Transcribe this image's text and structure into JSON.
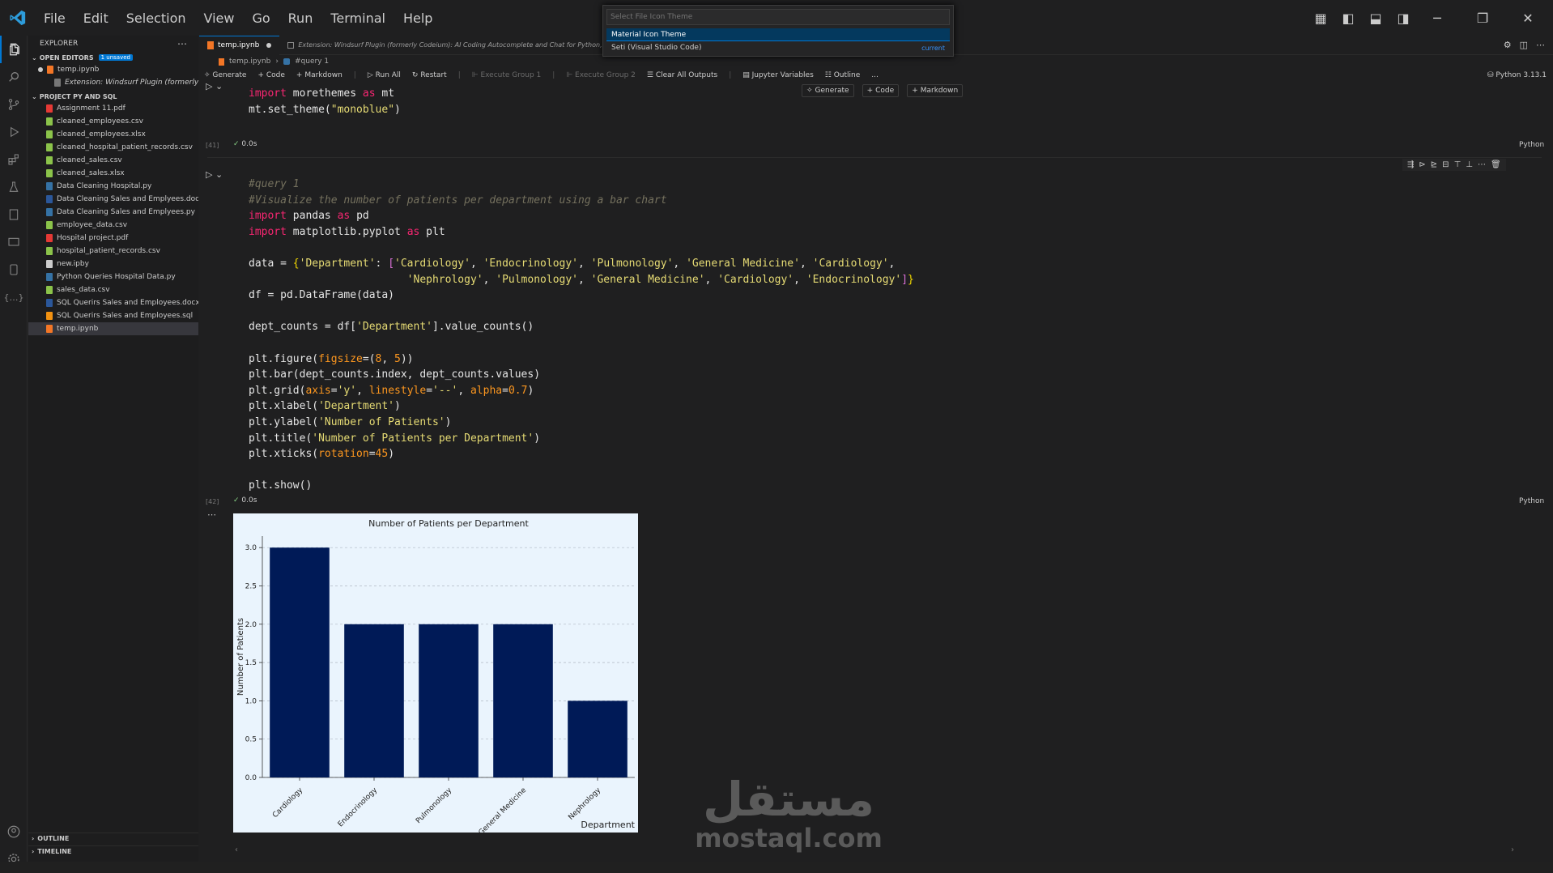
{
  "menu": [
    "File",
    "Edit",
    "Selection",
    "View",
    "Go",
    "Run",
    "Terminal",
    "Help"
  ],
  "palette": {
    "placeholder": "Select File Icon Theme",
    "options": [
      {
        "label": "Material Icon Theme",
        "tag": ""
      },
      {
        "label": "Seti (Visual Studio Code)",
        "tag": "current"
      }
    ]
  },
  "sidebar": {
    "title": "EXPLORER",
    "open_editors": "OPEN EDITORS",
    "unsaved": "1 unsaved",
    "open_files": [
      "temp.ipynb",
      "Extension: Windsurf Plugin (formerly ..."
    ],
    "project": "PROJECT PY AND SQL",
    "files": [
      {
        "name": "Assignment 11.pdf",
        "color": "#e53935"
      },
      {
        "name": "cleaned_employees.csv",
        "color": "#8bc34a"
      },
      {
        "name": "cleaned_employees.xlsx",
        "color": "#8bc34a"
      },
      {
        "name": "cleaned_hospital_patient_records.csv",
        "color": "#8bc34a"
      },
      {
        "name": "cleaned_sales.csv",
        "color": "#8bc34a"
      },
      {
        "name": "cleaned_sales.xlsx",
        "color": "#8bc34a"
      },
      {
        "name": "Data Cleaning Hospital.py",
        "color": "#3572a5"
      },
      {
        "name": "Data Cleaning Sales and Emplyees.docx",
        "color": "#2b579a"
      },
      {
        "name": "Data Cleaning Sales and Emplyees.py",
        "color": "#3572a5"
      },
      {
        "name": "employee_data.csv",
        "color": "#8bc34a"
      },
      {
        "name": "Hospital project.pdf",
        "color": "#e53935"
      },
      {
        "name": "hospital_patient_records.csv",
        "color": "#8bc34a"
      },
      {
        "name": "new.ipby",
        "color": "#cccccc"
      },
      {
        "name": "Python Queries Hospital Data.py",
        "color": "#3572a5"
      },
      {
        "name": "sales_data.csv",
        "color": "#8bc34a"
      },
      {
        "name": "SQL Querirs Sales and Employees.docx",
        "color": "#2b579a"
      },
      {
        "name": "SQL Querirs Sales and Employees.sql",
        "color": "#f29111"
      },
      {
        "name": "temp.ipynb",
        "color": "#f37626"
      }
    ],
    "outline": "OUTLINE",
    "timeline": "TIMELINE"
  },
  "tabs": [
    {
      "label": "temp.ipynb"
    },
    {
      "label": "Extension: Windsurf Plugin (formerly Codeium): AI Coding Autocomplete and Chat for Python, J..."
    }
  ],
  "breadcrumb": [
    "temp.ipynb",
    "#query 1"
  ],
  "toolbar": {
    "items": [
      "Generate",
      "Code",
      "Markdown",
      "Run All",
      "Restart",
      "Execute Group 1",
      "Execute Group 2",
      "Clear All Outputs",
      "Jupyter Variables",
      "Outline",
      "..."
    ],
    "kernel": "Python 3.13.1"
  },
  "cell_toolbar": {
    "generate": "Generate",
    "code": "Code",
    "markdown": "Markdown"
  },
  "cells": [
    {
      "exec": "[41]",
      "time": "0.0s",
      "lang": "Python"
    },
    {
      "exec": "[42]",
      "time": "0.0s",
      "lang": "Python"
    }
  ],
  "watermark": {
    "arabic": "مستقل",
    "latin": "mostaql.com"
  },
  "chart_data": {
    "type": "bar",
    "title": "Number of Patients per Department",
    "xlabel": "Department",
    "ylabel": "Number of Patients",
    "categories": [
      "Cardiology",
      "Endocrinology",
      "Pulmonology",
      "General Medicine",
      "Nephrology"
    ],
    "values": [
      3,
      2,
      2,
      2,
      1
    ],
    "ylim": [
      0,
      3.15
    ],
    "yticks": [
      "0.0",
      "0.5",
      "1.0",
      "1.5",
      "2.0",
      "2.5",
      "3.0"
    ],
    "grid": "y dashed",
    "bar_color": "#001a57",
    "background": "#eaf4fd"
  }
}
